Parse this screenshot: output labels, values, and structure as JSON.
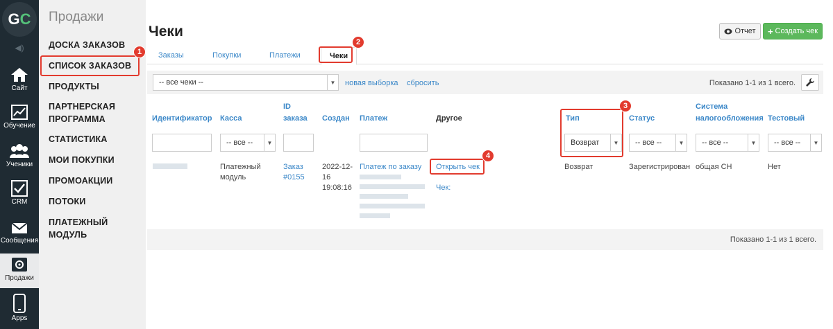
{
  "rail": {
    "logo": "GC",
    "items": [
      {
        "label": "Сайт",
        "icon": "home-icon"
      },
      {
        "label": "Обучение",
        "icon": "chart-icon"
      },
      {
        "label": "Ученики",
        "icon": "users-icon"
      },
      {
        "label": "CRM",
        "icon": "check-icon"
      },
      {
        "label": "Сообщения",
        "icon": "mail-icon"
      },
      {
        "label": "Продажи",
        "icon": "safe-icon"
      },
      {
        "label": "Apps",
        "icon": "phone-icon"
      }
    ]
  },
  "menu": {
    "title": "Продажи",
    "items": [
      "ДОСКА ЗАКАЗОВ",
      "СПИСОК ЗАКАЗОВ",
      "ПРОДУКТЫ",
      "ПАРТНЕРСКАЯ ПРОГРАММА",
      "СТАТИСТИКА",
      "МОИ ПОКУПКИ",
      "ПРОМОАКЦИИ",
      "ПОТОКИ",
      "ПЛАТЕЖНЫЙ МОДУЛЬ"
    ]
  },
  "page": {
    "title": "Чеки",
    "report_btn": "Отчет",
    "create_btn": "Создать чек",
    "tabs": [
      "Заказы",
      "Покупки",
      "Платежи",
      "Чеки"
    ],
    "filter": {
      "select_value": "-- все чеки --",
      "new_selection": "новая выборка",
      "reset": "сбросить",
      "shown": "Показано 1-1 из 1 всего."
    },
    "columns": {
      "id": "Идентификатор",
      "kassa": "Касса",
      "order_id_1": "ID",
      "order_id_2": "заказа",
      "created": "Создан",
      "payment": "Платеж",
      "other": "Другое",
      "type": "Тип",
      "status": "Статус",
      "tax_1": "Система",
      "tax_2": "налогообложения",
      "test": "Тестовый"
    },
    "col_filters": {
      "kassa": "-- все --",
      "type": "Возврат",
      "status": "-- все --",
      "tax": "-- все --",
      "test": "-- все --"
    },
    "row": {
      "kassa_1": "Платежный",
      "kassa_2": "модуль",
      "order_1": "Заказ",
      "order_2": "#0155",
      "created_1": "2022-12-",
      "created_2": "16",
      "created_3": "19:08:16",
      "payment": "Платеж по заказу",
      "open_check": "Открыть чек",
      "check_label": "Чек:",
      "type": "Возврат",
      "status": "Зарегистрирован",
      "tax": "общая СН",
      "test": "Нет"
    },
    "shown_bottom": "Показано 1-1 из 1 всего."
  },
  "annotations": [
    "1",
    "2",
    "3",
    "4"
  ],
  "colors": {
    "rail_bg": "#1f2b33",
    "accent_link": "#3a87c8",
    "create_green": "#5cb85c",
    "highlight_red": "#e23b2e"
  }
}
